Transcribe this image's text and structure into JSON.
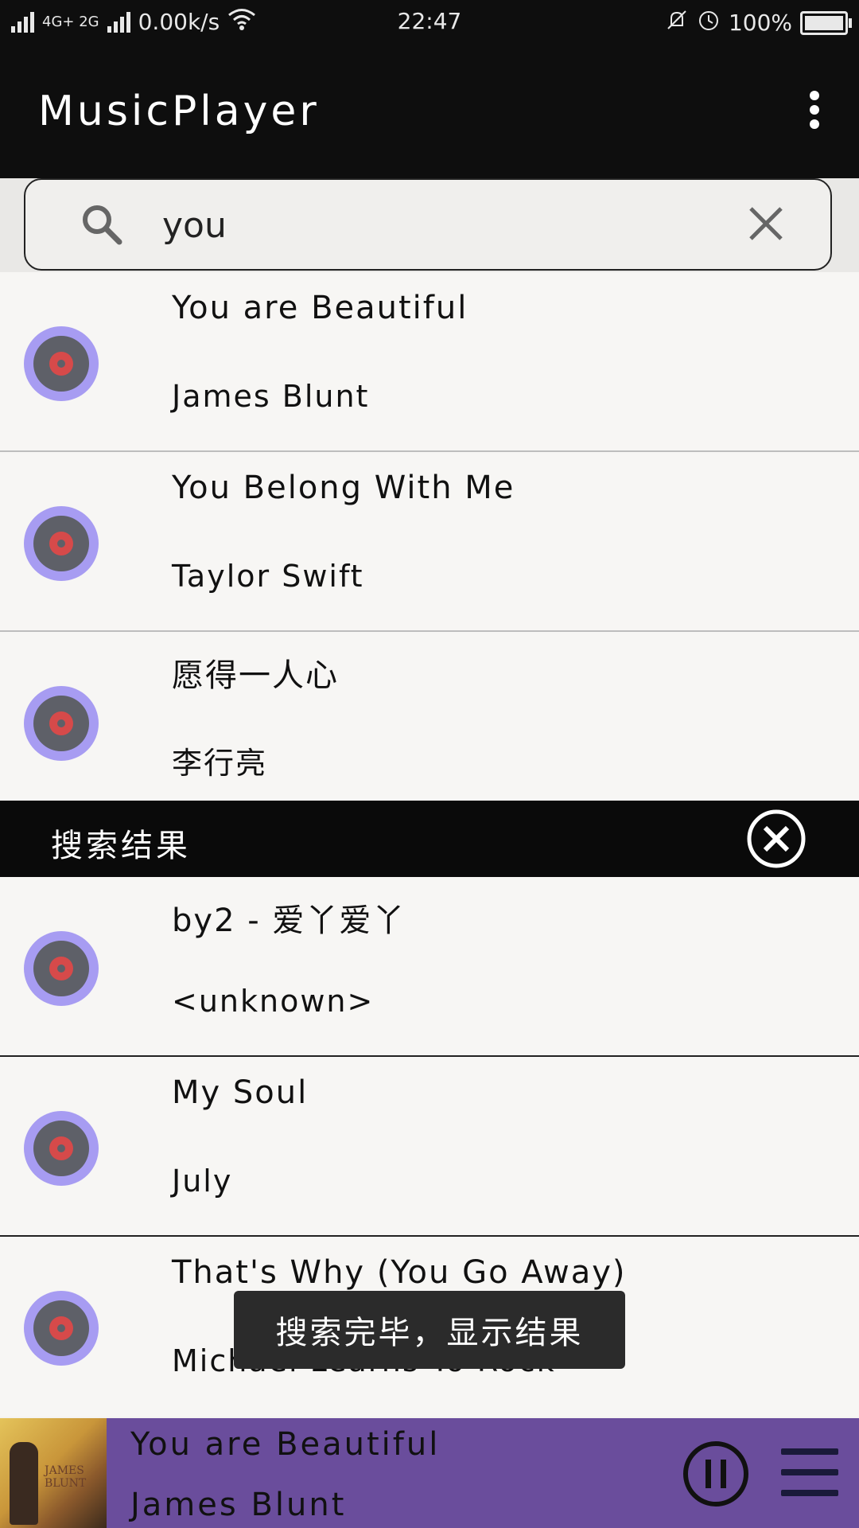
{
  "status_bar": {
    "network_left": "2G",
    "network_mid": "4G+ 2G",
    "speed": "0.00k/s",
    "time": "22:47",
    "battery": "100%"
  },
  "app_bar": {
    "title": "MusicPlayer",
    "menu_icon": "more-vert-icon"
  },
  "search": {
    "value": "you",
    "search_icon": "search-icon",
    "clear_icon": "close-icon"
  },
  "search_results_top": [
    {
      "title": "You are Beautiful",
      "artist": "James Blunt"
    },
    {
      "title": "You Belong With Me",
      "artist": "Taylor Swift"
    },
    {
      "title": "愿得一人心",
      "artist": "李行亮"
    }
  ],
  "results_bar": {
    "label": "搜索结果",
    "close_icon": "circle-close-icon"
  },
  "library": [
    {
      "title": "by2 - 爱丫爱丫",
      "artist": "<unknown>"
    },
    {
      "title": "My Soul",
      "artist": "July"
    },
    {
      "title": "That's Why (You Go Away)",
      "artist": "Michael Learns To Rock"
    }
  ],
  "toast": {
    "message": "搜索完毕，显示结果"
  },
  "now_playing": {
    "title": "You are Beautiful",
    "artist": "James Blunt",
    "cover_text": "JAMES BLUNT",
    "pause_icon": "pause-icon",
    "queue_icon": "menu-icon"
  },
  "colors": {
    "disc_bg": "#a79cf2",
    "player_bg": "#6a4d9c",
    "appbar_bg": "#0e0e0e"
  }
}
